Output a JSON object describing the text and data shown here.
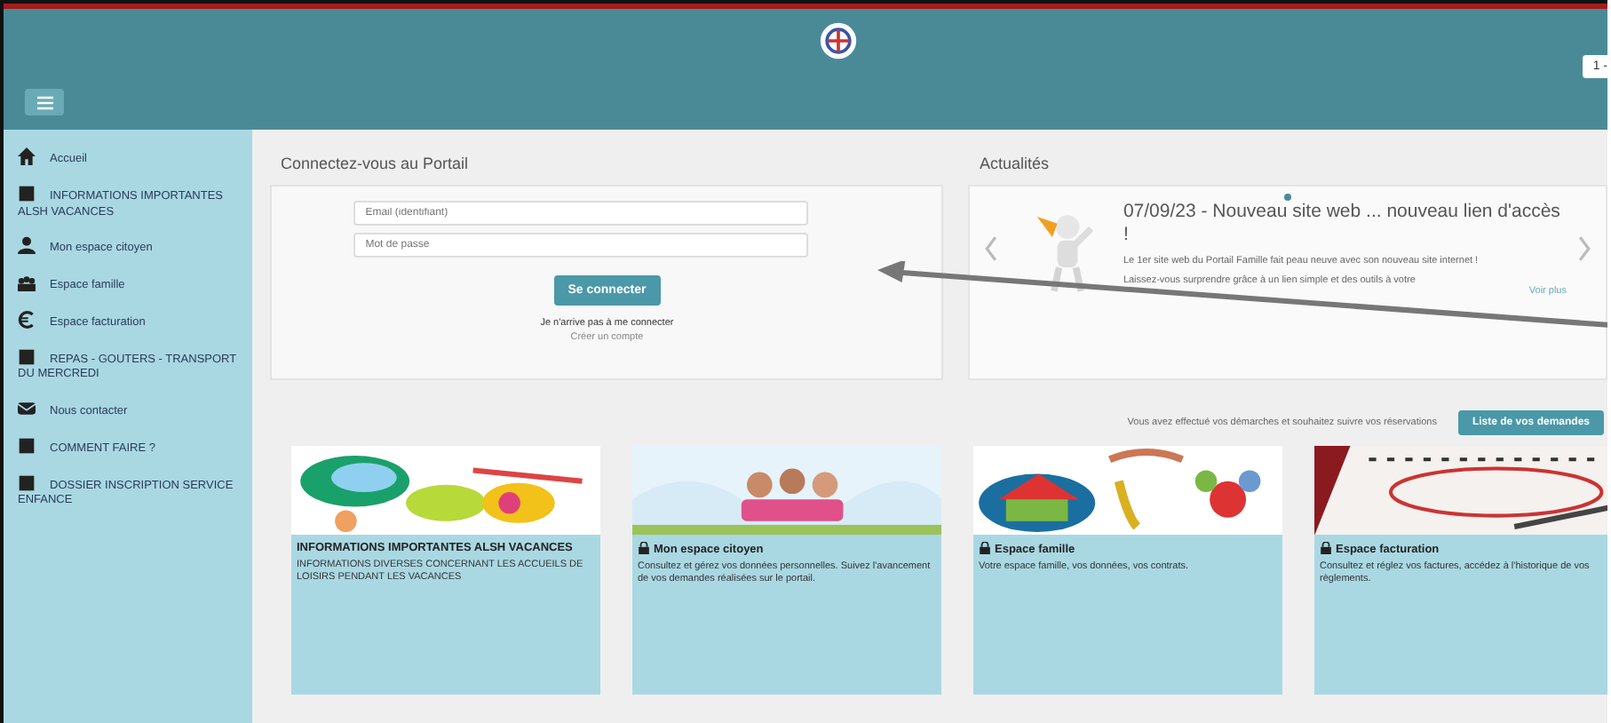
{
  "header": {
    "user_button": "1 -"
  },
  "sidebar": {
    "items": [
      {
        "label": "Accueil"
      },
      {
        "label": "INFORMATIONS IMPORTANTES ALSH VACANCES"
      },
      {
        "label": "Mon espace citoyen"
      },
      {
        "label": "Espace famille"
      },
      {
        "label": "Espace facturation"
      },
      {
        "label": "REPAS - GOUTERS - TRANSPORT DU MERCREDI"
      },
      {
        "label": "Nous contacter"
      },
      {
        "label": "COMMENT FAIRE ?"
      },
      {
        "label": "DOSSIER INSCRIPTION SERVICE ENFANCE"
      }
    ]
  },
  "login": {
    "title": "Connectez-vous au Portail",
    "fields": [
      {
        "placeholder": "Email (identifiant)"
      },
      {
        "placeholder": "Mot de passe"
      }
    ],
    "button": "Se connecter",
    "help": "Je n'arrive pas à me connecter",
    "create_link": "Créer un compte"
  },
  "news": {
    "title": "Actualités",
    "headline": "07/09/23 - Nouveau site web ... nouveau lien d'accès !",
    "paragraphs": [
      "Le 1er site web du Portail Famille fait peau neuve avec son nouveau site internet !",
      "Laissez-vous surprendre grâce à un lien simple et des outils à votre"
    ],
    "more": "Voir plus",
    "slides": [
      {
        "selected": true
      }
    ]
  },
  "requests": {
    "text": "Vous avez effectué vos démarches et souhaitez suivre vos réservations",
    "button": "Liste de vos demandes"
  },
  "cards": [
    {
      "title": "INFORMATIONS IMPORTANTES ALSH VACANCES",
      "description": "INFORMATIONS DIVERSES CONCERNANT LES ACCUEILS DE LOISIRS PENDANT LES VACANCES"
    },
    {
      "title": "Mon espace citoyen",
      "description": "Consultez et gérez vos données personnelles. Suivez l'avancement de vos demandes réalisées sur le portail."
    },
    {
      "title": "Espace famille",
      "description": "Votre espace famille, vos données, vos contrats."
    },
    {
      "title": "Espace facturation",
      "description": "Consultez et réglez vos factures, accédez à l'historique de vos règlements."
    }
  ]
}
